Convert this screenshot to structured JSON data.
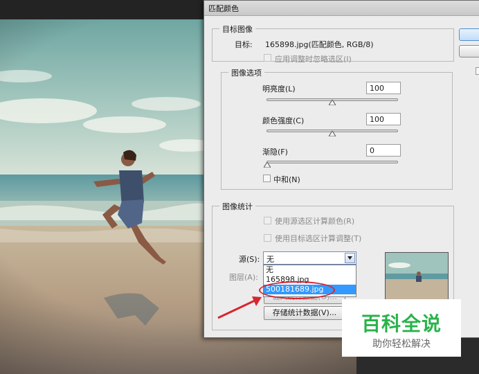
{
  "dialog": {
    "title": "匹配颜色",
    "target_group": {
      "title": "目标图像",
      "target_label": "目标:",
      "target_value": "165898.jpg(匹配颜色, RGB/8)",
      "ignore_selection_label": "应用调整时忽略选区(I)"
    },
    "image_options": {
      "title": "图像选项",
      "luminance_label": "明亮度(L)",
      "luminance_value": "100",
      "luminance_level": 0.5,
      "color_intensity_label": "颜色强度(C)",
      "color_intensity_value": "100",
      "color_intensity_level": 0.5,
      "fade_label": "渐隐(F)",
      "fade_value": "0",
      "fade_level": 0,
      "neutralize_label": "中和(N)"
    },
    "image_statistics": {
      "title": "图像统计",
      "use_source_selection_label": "使用源选区计算颜色(R)",
      "use_target_selection_label": "使用目标选区计算调整(T)",
      "source_label": "源(S):",
      "source_value": "无",
      "layer_label": "图层(A):",
      "dropdown_options": [
        "无",
        "165898.jpg",
        "500181689.jpg"
      ],
      "dropdown_selected": "500181689.jpg",
      "load_stats_label": "载入统计数据(O)...",
      "save_stats_label": "存储统计数据(V)..."
    }
  },
  "watermark": {
    "title": "百科全说",
    "subtitle": "助你轻松解决"
  },
  "colors": {
    "highlight": "#3399ff",
    "annotation_red": "#d7262f",
    "watermark_green": "#29b34a"
  }
}
